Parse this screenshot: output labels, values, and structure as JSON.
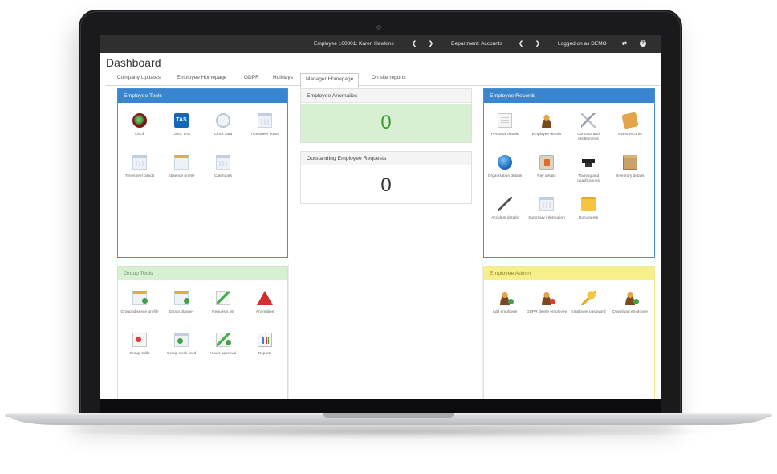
{
  "topbar": {
    "employee": "Employee 100001: Karen Hawkins",
    "department": "Department: Accounts",
    "logged": "Logged on as DEMO"
  },
  "page": {
    "title": "Dashboard"
  },
  "tabs": [
    {
      "label": "Company Updates"
    },
    {
      "label": "Employee Homepage"
    },
    {
      "label": "GDPR"
    },
    {
      "label": "Holidays"
    },
    {
      "label": "Manager Homepage"
    },
    {
      "label": "On site reports"
    }
  ],
  "active_tab": "Manager Homepage",
  "employee_tools": {
    "title": "Employee Tools",
    "items": [
      {
        "label": "Clock",
        "icon": "clock-icon"
      },
      {
        "label": "Clock TAS",
        "icon": "tas-icon",
        "icon_text": "TAS"
      },
      {
        "label": "Clock card",
        "icon": "clock-card-icon"
      },
      {
        "label": "Timesheet hours",
        "icon": "timesheet-icon"
      },
      {
        "label": "Timesheet bands",
        "icon": "timesheet-bands-icon"
      },
      {
        "label": "Absence profile",
        "icon": "absence-profile-icon"
      },
      {
        "label": "Calendars",
        "icon": "calendar-icon"
      }
    ]
  },
  "anomalies": {
    "title": "Employee Anomalies",
    "count": "0"
  },
  "requests": {
    "title": "Outstanding Employee Requests",
    "count": "0"
  },
  "employee_records": {
    "title": "Employee Records",
    "items": [
      {
        "label": "Personal details",
        "icon": "personal-details-icon"
      },
      {
        "label": "Employee details",
        "icon": "employee-details-icon"
      },
      {
        "label": "Contract and entitlements",
        "icon": "contract-icon"
      },
      {
        "label": "Event records",
        "icon": "event-records-icon"
      },
      {
        "label": "Organisation details",
        "icon": "organisation-icon"
      },
      {
        "label": "Pay details",
        "icon": "pay-details-icon"
      },
      {
        "label": "Training and qualifications",
        "icon": "training-icon"
      },
      {
        "label": "Inventory details",
        "icon": "inventory-icon"
      },
      {
        "label": "Accident details",
        "icon": "accident-icon"
      },
      {
        "label": "Summary information",
        "icon": "summary-icon"
      },
      {
        "label": "Documents",
        "icon": "documents-folder-icon"
      }
    ]
  },
  "group_tools": {
    "title": "Group Tools",
    "items": [
      {
        "label": "Group absence profile",
        "icon": "group-absence-icon"
      },
      {
        "label": "Group planner",
        "icon": "group-planner-icon"
      },
      {
        "label": "Requests list",
        "icon": "requests-list-icon"
      },
      {
        "label": "Anomalies",
        "icon": "anomalies-warning-icon"
      },
      {
        "label": "Group skills",
        "icon": "group-skills-icon"
      },
      {
        "label": "Group clock card",
        "icon": "group-clock-card-icon"
      },
      {
        "label": "Hours approval",
        "icon": "hours-approval-icon"
      },
      {
        "label": "Reports",
        "icon": "reports-chart-icon"
      }
    ]
  },
  "employee_admin": {
    "title": "Employee Admin",
    "items": [
      {
        "label": "Add employee",
        "icon": "add-employee-icon"
      },
      {
        "label": "GDPR delete employee",
        "icon": "delete-employee-icon"
      },
      {
        "label": "Employee password",
        "icon": "key-icon"
      },
      {
        "label": "Download employee",
        "icon": "download-employee-icon"
      }
    ]
  },
  "colors": {
    "panel_blue": "#3a85cf",
    "anomaly_green": "#d8efd2",
    "count_green": "#3f9a3a",
    "admin_yellow": "#f7f08a",
    "topbar_bg": "#2f2f2f"
  }
}
